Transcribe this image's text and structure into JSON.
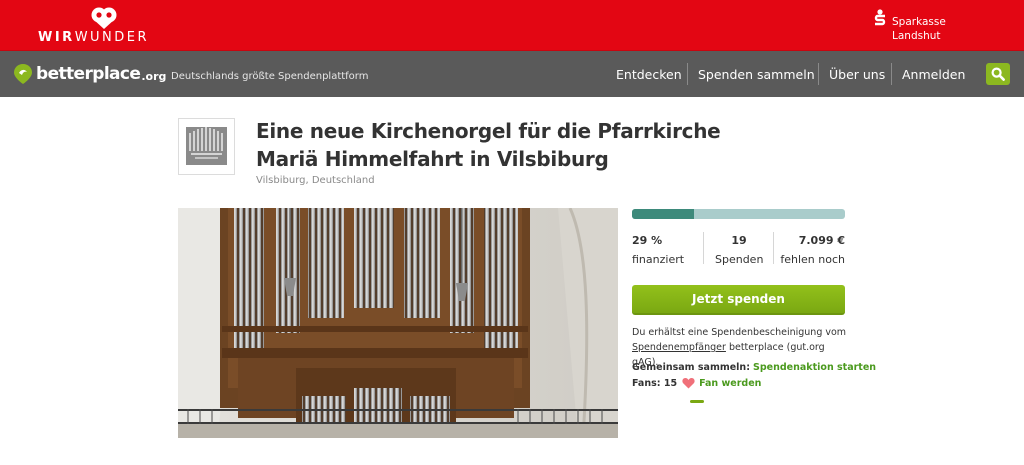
{
  "brand_bar": {
    "logo_text_bold": "WIR",
    "logo_text_thin": "WUNDER",
    "partner_line1": "Sparkasse",
    "partner_line2": "Landshut"
  },
  "nav": {
    "logo_name": "betterplace",
    "logo_tld": ".org",
    "tagline": "Deutschlands größte Spendenplattform",
    "links": [
      "Entdecken",
      "Spenden sammeln",
      "Über uns",
      "Anmelden"
    ],
    "search_icon": "search-icon"
  },
  "project": {
    "title": "Eine neue Kirchenorgel für die Pfarrkirche Mariä Himmelfahrt in Vilsbiburg",
    "location": "Vilsbiburg, Deutschland"
  },
  "funding": {
    "progress_fraction": 0.29,
    "percent": "29 %",
    "percent_label": "finanziert",
    "donations": "19",
    "donations_label": "Spenden",
    "missing": "7.099 €",
    "missing_label": "fehlen noch"
  },
  "actions": {
    "donate_label": "Jetzt spenden",
    "receipt_text_before": "Du erhältst eine Spendenbescheinigung vom",
    "receipt_link": "Spendenempfänger",
    "receipt_text_after": "betterplace (gut.org gAG).",
    "collect_label": "Gemeinsam sammeln:",
    "collect_link": "Spendenaktion starten",
    "fans_label": "Fans: 15",
    "fan_link": "Fan werden"
  },
  "colors": {
    "brand_red": "#e30613",
    "nav_grey": "#5a5a5a",
    "accent_green": "#8cb820",
    "progress_fill": "#3d8a7b",
    "progress_track": "#a9cccb"
  }
}
